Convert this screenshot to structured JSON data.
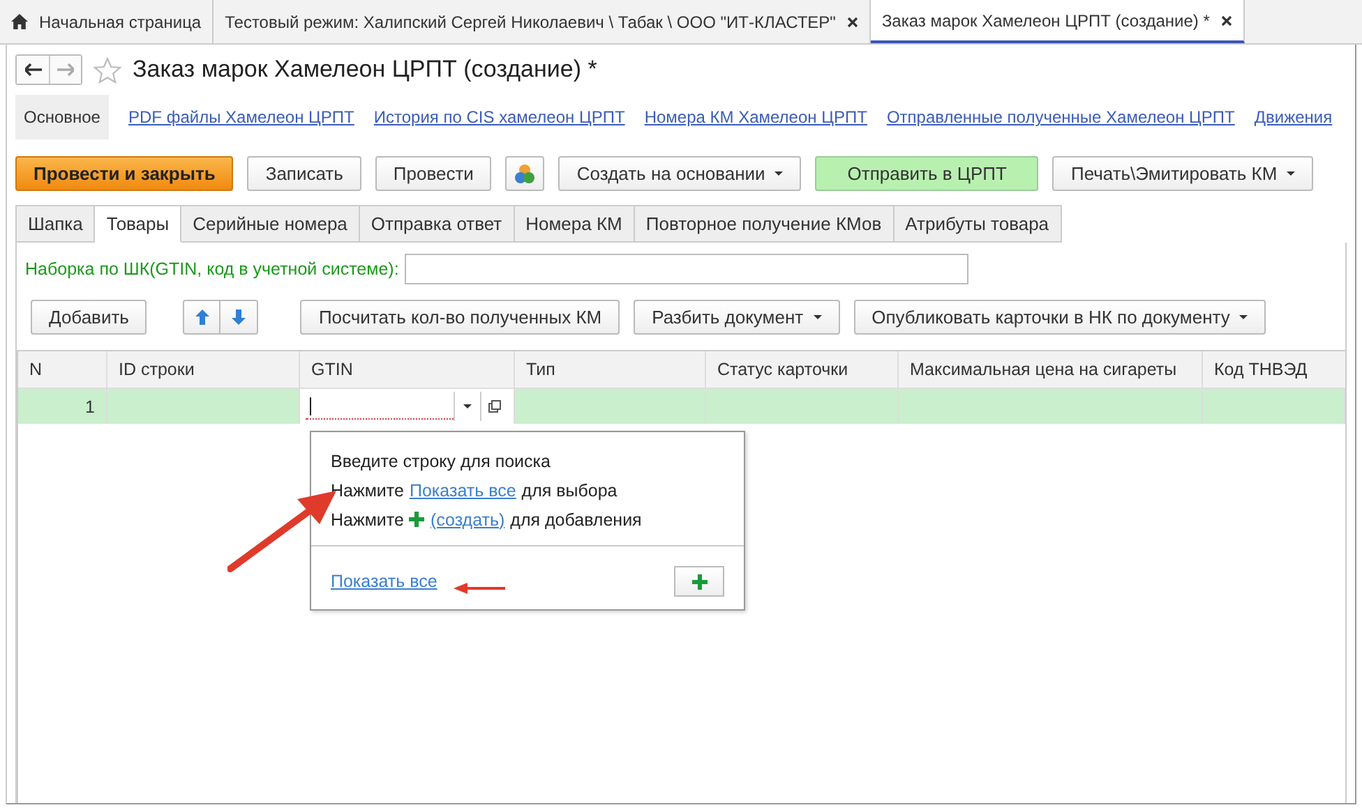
{
  "window_tabs": [
    {
      "label": "Начальная страница",
      "kind": "home",
      "selected": false
    },
    {
      "label": "Тестовый режим:  Халипский Сергей Николаевич \\ Табак \\ ООО \"ИТ-КЛАСТЕР\"",
      "kind": "closable",
      "selected": false
    },
    {
      "label": "Заказ марок Хамелеон ЦРПТ (создание) *",
      "kind": "closable",
      "selected": true
    }
  ],
  "title": "Заказ марок Хамелеон ЦРПТ (создание) *",
  "nav_links": [
    {
      "label": "Основное",
      "selected": true
    },
    {
      "label": "PDF файлы  Хамелеон ЦРПТ",
      "selected": false
    },
    {
      "label": "История по CIS хамелеон ЦРПТ",
      "selected": false
    },
    {
      "label": "Номера КМ Хамелеон ЦРПТ",
      "selected": false
    },
    {
      "label": "Отправленные полученные Хамелеон ЦРПТ",
      "selected": false
    },
    {
      "label": "Движения",
      "selected": false
    }
  ],
  "toolbar": [
    {
      "label": "Провести и закрыть",
      "kind": "primary"
    },
    {
      "label": "Записать",
      "kind": "plain"
    },
    {
      "label": "Провести",
      "kind": "plain"
    },
    {
      "kind": "icon"
    },
    {
      "label": "Создать на основании",
      "kind": "dropdown"
    },
    {
      "label": "Отправить в ЦРПТ",
      "kind": "green"
    },
    {
      "label": "Печать\\Эмитировать КМ",
      "kind": "dropdown"
    }
  ],
  "form_tabs": [
    {
      "label": "Шапка",
      "selected": false
    },
    {
      "label": "Товары",
      "selected": true
    },
    {
      "label": "Серийные номера",
      "selected": false
    },
    {
      "label": "Отправка ответ",
      "selected": false
    },
    {
      "label": "Номера КМ",
      "selected": false
    },
    {
      "label": "Повторное получение КМов",
      "selected": false
    },
    {
      "label": "Атрибуты товара",
      "selected": false
    }
  ],
  "barcode_field": {
    "label": "Наборка по ШК(GTIN, код в учетной системе):"
  },
  "actions": [
    {
      "label": "Добавить",
      "kind": "plain"
    },
    {
      "kind": "up"
    },
    {
      "kind": "down"
    },
    {
      "label": "Посчитать кол-во полученных КМ",
      "kind": "plain"
    },
    {
      "label": "Разбить документ",
      "kind": "dropdown"
    },
    {
      "label": "Опубликовать карточки в НК по документу",
      "kind": "dropdown"
    }
  ],
  "table": {
    "columns": [
      "N",
      "ID строки",
      "GTIN",
      "Тип",
      "Статус карточки",
      "Максимальная цена на сигареты",
      "Код ТНВЭД"
    ],
    "rows": [
      {
        "n": "1",
        "selected": true
      }
    ]
  },
  "dropdown": {
    "hint": "Введите строку для поиска",
    "show_line": {
      "before": "Нажмите",
      "link": "Показать все",
      "after": "для выбора"
    },
    "create_line": {
      "before": "Нажмите",
      "link": " (создать)",
      "after": "для добавления"
    },
    "footer_link": "Показать все"
  }
}
